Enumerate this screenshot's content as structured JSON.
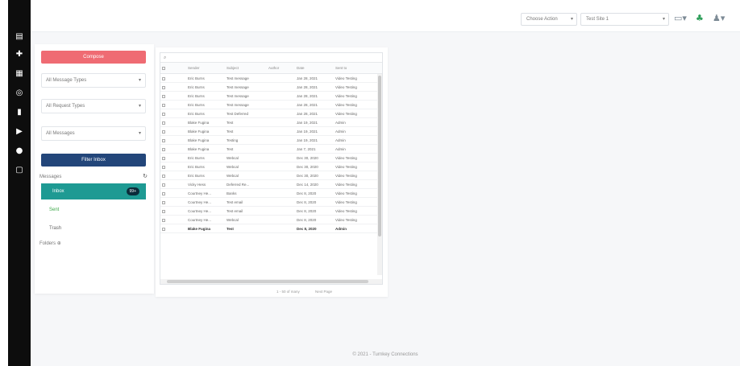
{
  "topbar": {
    "action_select": "Choose Action",
    "site_select": "Test Site 1",
    "icons": [
      "desktop-icon",
      "users-icon",
      "user-icon"
    ]
  },
  "sidenav": {
    "icons": [
      "dashboard-icon",
      "plus-icon",
      "calendar-icon",
      "target-icon",
      "chart-icon",
      "play-icon",
      "chat-icon",
      "square-icon"
    ]
  },
  "left_panel": {
    "compose_label": "Compose",
    "filters": [
      "All Message Types",
      "All Request Types",
      "All Messages"
    ],
    "filter_button": "Filter Inbox",
    "messages_label": "Messages",
    "inbox_label": "Inbox",
    "inbox_badge": "99+",
    "sent_label": "Sent",
    "trash_label": "Trash",
    "folders_label": "Folders"
  },
  "grid": {
    "columns": [
      "",
      "",
      "Sender",
      "Subject",
      "Author",
      "Date",
      "Sent to"
    ],
    "rows": [
      [
        "",
        "",
        "Eric Burns",
        "Test message",
        "",
        "Jan 28, 2021",
        "Video Testing"
      ],
      [
        "",
        "",
        "Eric Burns",
        "Test message",
        "",
        "Jan 28, 2021",
        "Video Testing"
      ],
      [
        "",
        "",
        "Eric Burns",
        "Test message",
        "",
        "Jan 28, 2021",
        "Video Testing"
      ],
      [
        "",
        "",
        "Eric Burns",
        "Test message",
        "",
        "Jan 28, 2021",
        "Video Testing"
      ],
      [
        "",
        "",
        "Eric Burns",
        "Test Deferred",
        "",
        "Jan 28, 2021",
        "Video Testing"
      ],
      [
        "",
        "",
        "Blake Fugina",
        "Test",
        "",
        "Jan 19, 2021",
        "Admin"
      ],
      [
        "",
        "",
        "Blake Fugina",
        "Test",
        "",
        "Jan 19, 2021",
        "Admin"
      ],
      [
        "",
        "",
        "Blake Fugina",
        "Testing",
        "",
        "Jan 19, 2021",
        "Admin"
      ],
      [
        "",
        "",
        "Blake Fugina",
        "Test",
        "",
        "Jan 7, 2021",
        "Admin"
      ],
      [
        "",
        "",
        "Eric Burns",
        "Webcal",
        "",
        "Dec 30, 2020",
        "Video Testing"
      ],
      [
        "",
        "",
        "Eric Burns",
        "Webcal",
        "",
        "Dec 30, 2020",
        "Video Testing"
      ],
      [
        "",
        "",
        "Eric Burns",
        "Webcal",
        "",
        "Dec 30, 2020",
        "Video Testing"
      ],
      [
        "",
        "",
        "Vicky Hess",
        "Deferred Re...",
        "",
        "Dec 14, 2020",
        "Video Testing"
      ],
      [
        "",
        "",
        "Courtney He...",
        "Banks",
        "",
        "Dec 8, 2020",
        "Video Testing"
      ],
      [
        "",
        "",
        "Courtney He...",
        "Test email",
        "",
        "Dec 8, 2020",
        "Video Testing"
      ],
      [
        "",
        "",
        "Courtney He...",
        "Test email",
        "",
        "Dec 8, 2020",
        "Video Testing"
      ],
      [
        "",
        "",
        "Courtney He...",
        "Webcal",
        "",
        "Dec 8, 2020",
        "Video Testing"
      ],
      [
        "",
        "",
        "Blake Fugina",
        "Test",
        "",
        "Dec 8, 2020",
        "Admin"
      ]
    ],
    "pager_left": "1 - 50 of many",
    "pager_right": "Next Page"
  },
  "footer": "© 2021 - Turnkey Connections"
}
